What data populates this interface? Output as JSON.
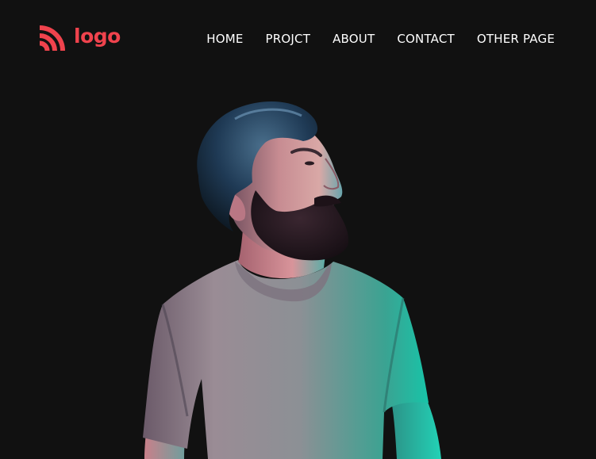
{
  "colors": {
    "background": "#111111",
    "accent": "#f0434d",
    "nav_text": "#ffffff"
  },
  "header": {
    "logo": {
      "icon": "rss-signal-icon",
      "text": "logo"
    },
    "nav": [
      {
        "label": "HOME"
      },
      {
        "label": "PROJCT"
      },
      {
        "label": "ABOUT"
      },
      {
        "label": "CONTACT"
      },
      {
        "label": "OTHER PAGE"
      }
    ]
  },
  "hero": {
    "image": "bearded-man-portrait-photo"
  }
}
